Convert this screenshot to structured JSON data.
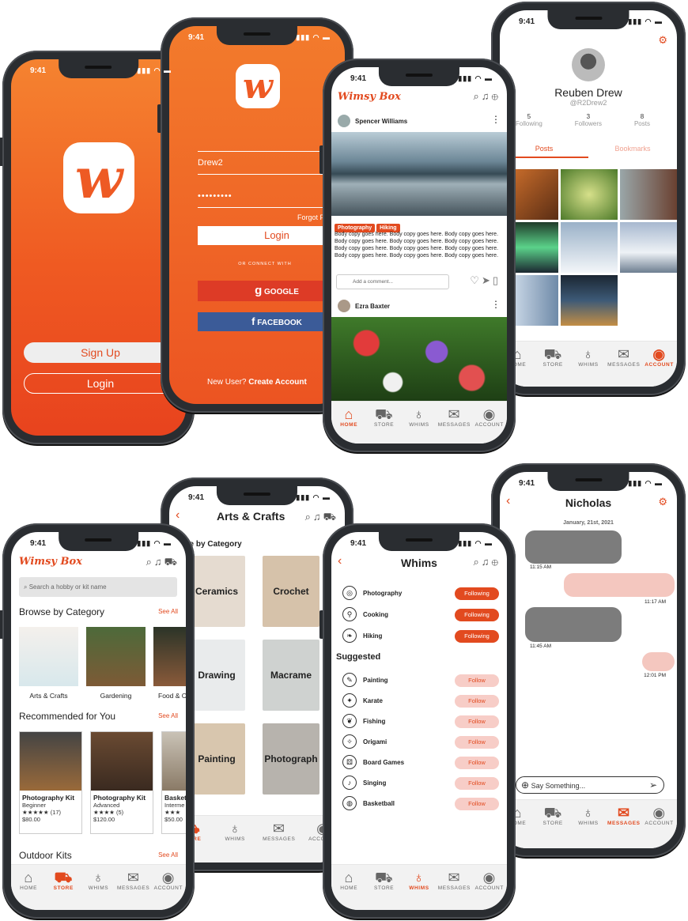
{
  "status_time": "9:41",
  "tabs": {
    "home": "HOME",
    "store": "STORE",
    "whims": "WHIMS",
    "messages": "MESSAGES",
    "account": "ACCOUNT"
  },
  "splash": {
    "signup": "Sign Up",
    "login": "Login"
  },
  "login": {
    "username_value": "Drew2",
    "password_value": "•••••••••",
    "forgot": "Forgot Passwo",
    "login_button": "Login",
    "or_connect": "OR CONNECT WITH",
    "google": "GOOGLE",
    "facebook": "FACEBOOK",
    "new_user": "New User?",
    "create_account": "Create Account"
  },
  "feed": {
    "brand": "Wimsy Box",
    "post1": {
      "author": "Spencer Williams",
      "tags": [
        "Photography",
        "Hiking"
      ],
      "body": "Body copy goes here. Body copy goes here. Body copy goes here. Body copy goes here. Body copy goes here. Body copy goes here. Body copy goes here.",
      "body2": "Body copy goes here. Body copy goes here. Body copy goes here. Body copy goes here. Body copy goes here."
    },
    "comment_placeholder": "Add a comment...",
    "post2": {
      "author": "Ezra Baxter"
    }
  },
  "profile": {
    "name": "Reuben Drew",
    "handle": "@R2Drew2",
    "stats": [
      {
        "n": "5",
        "l": "Following"
      },
      {
        "n": "3",
        "l": "Followers"
      },
      {
        "n": "8",
        "l": "Posts"
      }
    ],
    "tab_posts": "Posts",
    "tab_bookmarks": "Bookmarks"
  },
  "store": {
    "brand": "Wimsy Box",
    "search_placeholder": "Search a hobby or kit name",
    "browse": "Browse by Category",
    "see_all": "See All",
    "categories": [
      "Arts & Crafts",
      "Gardening",
      "Food & C"
    ],
    "recommended": "Recommended for You",
    "kits": [
      {
        "title": "Photography Kit",
        "level": "Beginner",
        "stars": "★★★★★",
        "count": "(17)",
        "price": "$80.00"
      },
      {
        "title": "Photography Kit",
        "level": "Advanced",
        "stars": "★★★★",
        "count": "(5)",
        "price": "$120.00"
      },
      {
        "title": "Basket",
        "level": "Interme",
        "stars": "★★★",
        "count": "",
        "price": "$50.00"
      }
    ],
    "outdoor": "Outdoor Kits"
  },
  "arts": {
    "title": "Arts & Crafts",
    "subtitle": "se by Category",
    "cats": [
      "Ceramics",
      "Crochet",
      "Drawing",
      "Macrame",
      "Painting",
      "Photograph"
    ]
  },
  "whims": {
    "title": "Whims",
    "following": [
      {
        "name": "Photography",
        "btn": "Following",
        "icon": "◎"
      },
      {
        "name": "Cooking",
        "btn": "Following",
        "icon": "⚲"
      },
      {
        "name": "Hiking",
        "btn": "Following",
        "icon": "❧"
      }
    ],
    "suggested_label": "Suggested",
    "suggested": [
      {
        "name": "Painting",
        "btn": "Follow",
        "icon": "✎"
      },
      {
        "name": "Karate",
        "btn": "Follow",
        "icon": "✦"
      },
      {
        "name": "Fishing",
        "btn": "Follow",
        "icon": "❦"
      },
      {
        "name": "Origami",
        "btn": "Follow",
        "icon": "✧"
      },
      {
        "name": "Board Games",
        "btn": "Follow",
        "icon": "⚄"
      },
      {
        "name": "Singing",
        "btn": "Follow",
        "icon": "♪"
      },
      {
        "name": "Basketball",
        "btn": "Follow",
        "icon": "◍"
      }
    ]
  },
  "chat": {
    "name": "Nicholas",
    "date": "January, 21st, 2021",
    "times": [
      "11:15 AM",
      "11:17 AM",
      "11:45 AM",
      "12:01 PM"
    ],
    "input_placeholder": "Say Something..."
  },
  "colors": {
    "brand": "#e24a1f",
    "light_brand": "#f7cdc7",
    "facebook": "#3b5b98",
    "google": "#dd3b26"
  }
}
